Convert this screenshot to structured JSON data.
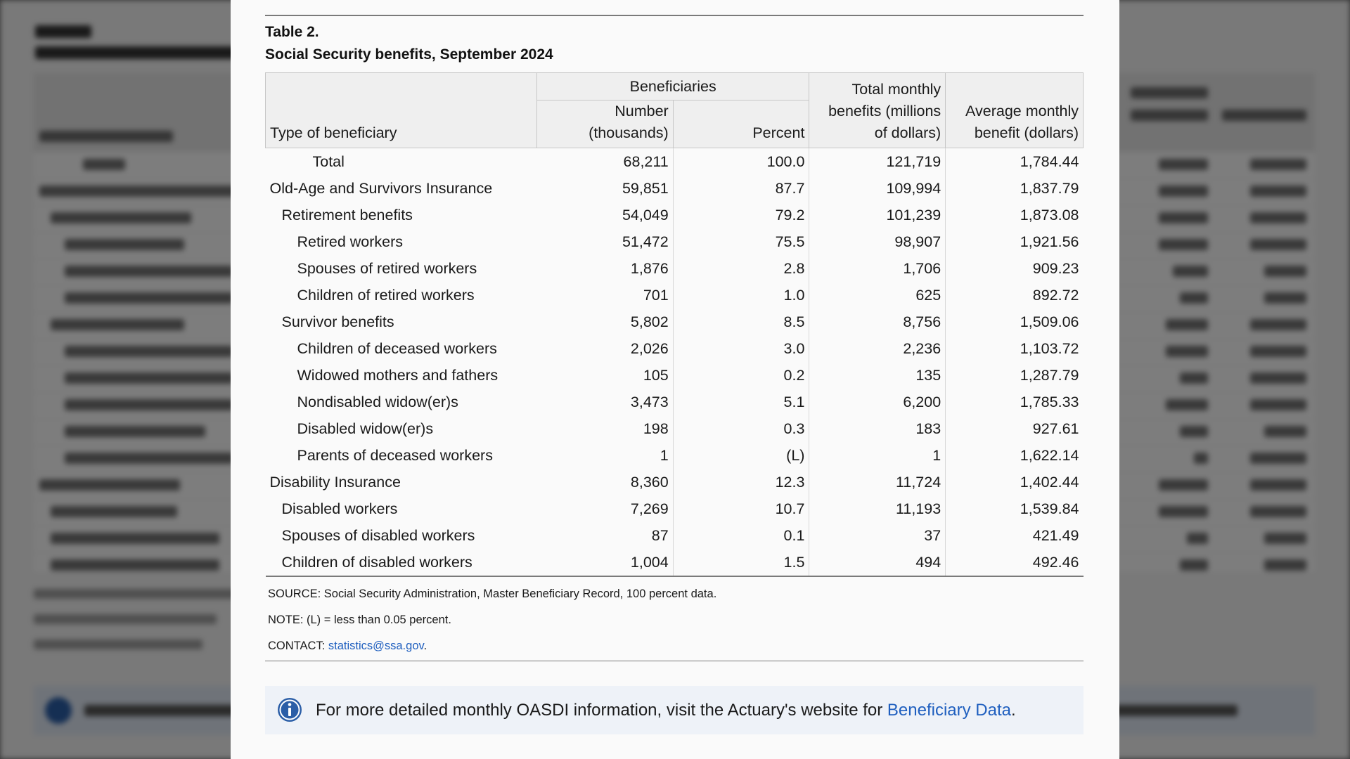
{
  "table": {
    "label": "Table 2.",
    "title": "Social Security benefits, September 2024",
    "headers": {
      "type": "Type of beneficiary",
      "group": "Beneficiaries",
      "number_line1": "Number",
      "number_line2": "(thousands)",
      "percent": "Percent",
      "total_line1": "Total monthly",
      "total_line2": "benefits (millions",
      "total_line3": "of dollars)",
      "avg_line1": "Average monthly",
      "avg_line2": "benefit (dollars)"
    },
    "rows": [
      {
        "type": "Total",
        "number": "68,211",
        "percent": "100.0",
        "total": "121,719",
        "average": "1,784.44"
      },
      {
        "type": "Old-Age and Survivors Insurance",
        "number": "59,851",
        "percent": "87.7",
        "total": "109,994",
        "average": "1,837.79"
      },
      {
        "type": "Retirement benefits",
        "number": "54,049",
        "percent": "79.2",
        "total": "101,239",
        "average": "1,873.08"
      },
      {
        "type": "Retired workers",
        "number": "51,472",
        "percent": "75.5",
        "total": "98,907",
        "average": "1,921.56"
      },
      {
        "type": "Spouses of retired workers",
        "number": "1,876",
        "percent": "2.8",
        "total": "1,706",
        "average": "909.23"
      },
      {
        "type": "Children of retired workers",
        "number": "701",
        "percent": "1.0",
        "total": "625",
        "average": "892.72"
      },
      {
        "type": "Survivor benefits",
        "number": "5,802",
        "percent": "8.5",
        "total": "8,756",
        "average": "1,509.06"
      },
      {
        "type": "Children of deceased workers",
        "number": "2,026",
        "percent": "3.0",
        "total": "2,236",
        "average": "1,103.72"
      },
      {
        "type": "Widowed mothers and fathers",
        "number": "105",
        "percent": "0.2",
        "total": "135",
        "average": "1,287.79"
      },
      {
        "type": "Nondisabled widow(er)s",
        "number": "3,473",
        "percent": "5.1",
        "total": "6,200",
        "average": "1,785.33"
      },
      {
        "type": "Disabled widow(er)s",
        "number": "198",
        "percent": "0.3",
        "total": "183",
        "average": "927.61"
      },
      {
        "type": "Parents of deceased workers",
        "number": "1",
        "percent": "(L)",
        "total": "1",
        "average": "1,622.14"
      },
      {
        "type": "Disability Insurance",
        "number": "8,360",
        "percent": "12.3",
        "total": "11,724",
        "average": "1,402.44"
      },
      {
        "type": "Disabled workers",
        "number": "7,269",
        "percent": "10.7",
        "total": "11,193",
        "average": "1,539.84"
      },
      {
        "type": "Spouses of disabled workers",
        "number": "87",
        "percent": "0.1",
        "total": "37",
        "average": "421.49"
      },
      {
        "type": "Children of disabled workers",
        "number": "1,004",
        "percent": "1.5",
        "total": "494",
        "average": "492.46"
      }
    ]
  },
  "notes": {
    "source": "SOURCE: Social Security Administration, Master Beneficiary Record, 100 percent data.",
    "note": "NOTE: (L) = less than 0.05 percent.",
    "contact_prefix": "CONTACT: ",
    "contact_link": "statistics@ssa.gov",
    "contact_suffix": "."
  },
  "info": {
    "icon": "info-icon",
    "text": "For more detailed monthly OASDI information, visit the Actuary's website for ",
    "link": "Beneficiary Data",
    "suffix": "."
  },
  "colors": {
    "link": "#1f5fbf",
    "header_bg": "#efefef",
    "info_bg": "#eef2f8",
    "info_icon": "#2b5ea7"
  }
}
